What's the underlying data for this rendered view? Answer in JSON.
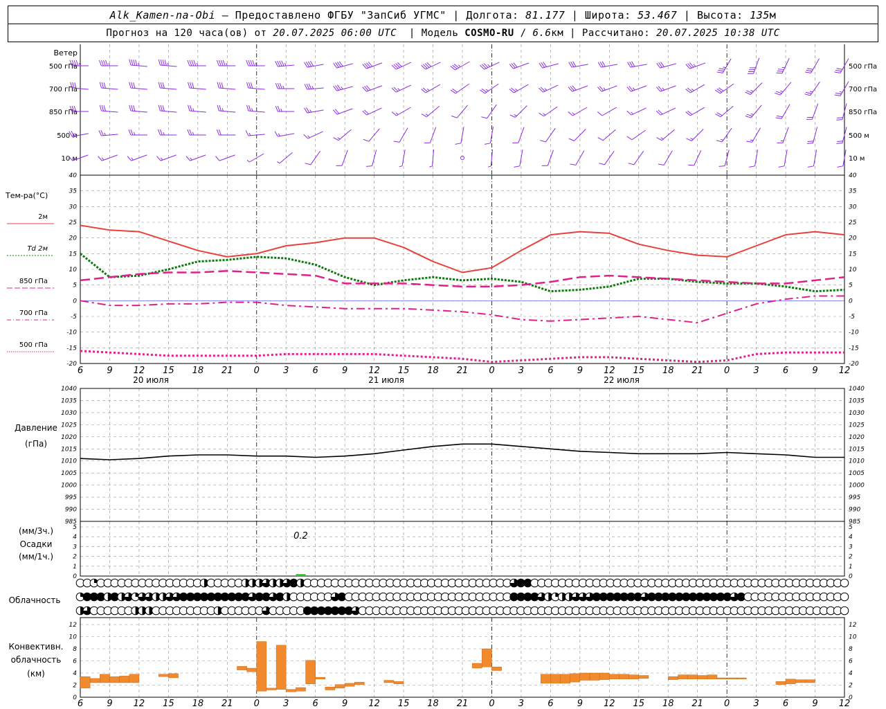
{
  "header": {
    "station": "Alk_Kamen-na-Obi",
    "provider": "Предоставлено ФГБУ \"ЗапСиб УГМС\"",
    "lon_label": "Долгота:",
    "lon": "81.177",
    "lat_label": "Широта:",
    "lat": "53.467",
    "alt_label": "Высота:",
    "alt": "135",
    "alt_unit": "м",
    "forecast_label": "Прогноз на 120 часа(ов) от",
    "forecast_time": "20.07.2025 06:00 UTC",
    "model_label": "Модель",
    "model": "COSMO-RU",
    "model_res": "6.6",
    "model_res_unit": "км",
    "calc_label": "Рассчитано:",
    "calc_time": "20.07.2025 10:38 UTC"
  },
  "colors": {
    "wind": "#8a2be2",
    "t2m": "#e8413c",
    "td2m": "#0a7a0a",
    "t850": "#e0208a",
    "t700": "#e0208a",
    "t500": "#e0208a",
    "pressure": "#000000",
    "precip": "#22cc22",
    "conv": "#f08a2c",
    "grid": "#999999"
  },
  "time_axis": {
    "hour_labels": [
      "6",
      "9",
      "12",
      "15",
      "18",
      "21",
      "0",
      "3",
      "6",
      "9",
      "12",
      "15",
      "18",
      "21",
      "0",
      "3",
      "6",
      "9",
      "12",
      "15",
      "18",
      "21",
      "0",
      "3",
      "6",
      "9",
      "12"
    ],
    "day_labels": [
      "20 июля",
      "21 июля",
      "22 июля"
    ]
  },
  "wind_panel": {
    "title": "Ветер",
    "levels": [
      "500 гПа",
      "700 гПа",
      "850 гПа",
      "500 м",
      "10 м"
    ]
  },
  "temp_panel": {
    "title": "Тем-ра(°С)",
    "legend": [
      "2м",
      "Td 2м",
      "850 гПа",
      "700 гПа",
      "500 гПа"
    ]
  },
  "pressure_panel": {
    "title": "Давление",
    "unit": "(гПа)"
  },
  "precip_panel": {
    "unit_top": "(мм/3ч.)",
    "title": "Осадки",
    "unit_bottom": "(мм/1ч.)",
    "max_label": "0.2"
  },
  "cloud_panel": {
    "title": "Облачность"
  },
  "conv_panel": {
    "title_line1": "Конвективн.",
    "title_line2": "облачность",
    "unit": "(км)"
  },
  "chart_data": [
    {
      "type": "line",
      "title": "Тем-ра(°С)",
      "ylim": [
        -20,
        40
      ],
      "y_ticks": [
        -20,
        -15,
        -10,
        -5,
        0,
        5,
        10,
        15,
        20,
        25,
        30,
        35,
        40
      ],
      "x_hours": [
        6,
        9,
        12,
        15,
        18,
        21,
        24,
        27,
        30,
        33,
        36,
        39,
        42,
        45,
        48,
        51,
        54,
        57,
        60,
        63,
        66,
        69,
        72,
        75,
        78,
        81,
        84
      ],
      "series": [
        {
          "name": "2м",
          "style": "solid",
          "values": [
            24,
            22.5,
            22,
            19,
            16,
            14,
            15,
            17.5,
            18.5,
            20,
            20,
            17,
            12.5,
            9,
            10.5,
            16,
            21,
            22,
            21.5,
            18,
            16,
            14.5,
            14,
            17.5,
            21,
            22,
            21
          ]
        },
        {
          "name": "Td 2м",
          "style": "dotted",
          "values": [
            15,
            7.5,
            8,
            10,
            12.5,
            13,
            14,
            13.5,
            11.5,
            7.5,
            5,
            6.5,
            7.5,
            6.5,
            7,
            6,
            3,
            3.5,
            4.5,
            7,
            7,
            6,
            5.5,
            5.5,
            4.5,
            3,
            3.5
          ]
        },
        {
          "name": "850 гПа",
          "style": "longdash",
          "values": [
            6.5,
            7.5,
            8.5,
            9,
            9,
            9.5,
            9,
            8.5,
            8,
            5.5,
            5.5,
            5.5,
            5,
            4.5,
            4.5,
            5,
            6,
            7.5,
            8,
            7.5,
            7,
            6.5,
            6,
            5.5,
            5.5,
            6.5,
            7.5
          ]
        },
        {
          "name": "700 гПа",
          "style": "dashdot",
          "values": [
            0,
            -1.5,
            -1.5,
            -1,
            -1,
            -0.5,
            -0.5,
            -1.5,
            -2,
            -2.5,
            -2.5,
            -2.5,
            -3,
            -3.5,
            -4.5,
            -6,
            -6.5,
            -6,
            -5.5,
            -5,
            -6,
            -7,
            -4,
            -1,
            0.5,
            1.5,
            1.5
          ]
        },
        {
          "name": "500 гПа",
          "style": "densedot",
          "values": [
            -16,
            -16.5,
            -17,
            -17.5,
            -17.5,
            -17.5,
            -17.5,
            -17,
            -17,
            -17,
            -17,
            -17.5,
            -18,
            -18.5,
            -19.5,
            -19,
            -18.5,
            -18,
            -18,
            -18.5,
            -19,
            -19.5,
            -19,
            -17,
            -16.5,
            -16.5,
            -16.5
          ]
        }
      ]
    },
    {
      "type": "line",
      "title": "Давление",
      "ylim": [
        985,
        1040
      ],
      "y_ticks": [
        985,
        990,
        995,
        1000,
        1005,
        1010,
        1015,
        1020,
        1025,
        1030,
        1035,
        1040
      ],
      "x_hours": [
        6,
        9,
        12,
        15,
        18,
        21,
        24,
        27,
        30,
        33,
        36,
        39,
        42,
        45,
        48,
        51,
        54,
        57,
        60,
        63,
        66,
        69,
        72,
        75,
        78,
        81,
        84
      ],
      "series": [
        {
          "name": "",
          "style": "solid",
          "values": [
            1011,
            1010.5,
            1011,
            1012,
            1012.5,
            1012.5,
            1012,
            1012,
            1011.5,
            1012,
            1013,
            1014.5,
            1016,
            1017,
            1017,
            1016,
            1015,
            1014,
            1013.5,
            1013,
            1013,
            1013,
            1013.5,
            1013,
            1012.5,
            1011.5,
            1011.5
          ]
        }
      ]
    },
    {
      "type": "bar",
      "title": "Осадки",
      "ylim": [
        0,
        5
      ],
      "y_ticks": [
        0,
        1,
        2,
        3,
        4,
        5
      ],
      "bars": [
        {
          "hour": 28.5,
          "value": 0.2
        }
      ]
    },
    {
      "type": "bar",
      "title": "Конвективн. облачность",
      "ylim": [
        0,
        12
      ],
      "y_ticks": [
        0,
        2,
        4,
        6,
        8,
        10,
        12
      ],
      "bars": [
        {
          "hour": 6.5,
          "base": 1.5,
          "top": 3.4
        },
        {
          "hour": 7.5,
          "base": 2.4,
          "top": 3.1
        },
        {
          "hour": 8.5,
          "base": 2.4,
          "top": 3.8
        },
        {
          "hour": 9.5,
          "base": 2.4,
          "top": 3.4
        },
        {
          "hour": 10.5,
          "base": 2.4,
          "top": 3.5
        },
        {
          "hour": 11.5,
          "base": 2.4,
          "top": 3.8
        },
        {
          "hour": 14.5,
          "base": 3.4,
          "top": 3.8
        },
        {
          "hour": 15.5,
          "base": 3.2,
          "top": 3.9
        },
        {
          "hour": 22.5,
          "base": 4.5,
          "top": 5.1
        },
        {
          "hour": 23.5,
          "base": 4.2,
          "top": 4.8
        },
        {
          "hour": 24.5,
          "base": 1.0,
          "top": 9.2
        },
        {
          "hour": 25.5,
          "base": 1.2,
          "top": 1.5
        },
        {
          "hour": 26.5,
          "base": 1.3,
          "top": 8.6
        },
        {
          "hour": 27.5,
          "base": 0.9,
          "top": 1.3
        },
        {
          "hour": 28.5,
          "base": 1.0,
          "top": 1.6
        },
        {
          "hour": 29.5,
          "base": 2.2,
          "top": 6.1
        },
        {
          "hour": 30.5,
          "base": 3.0,
          "top": 3.3
        },
        {
          "hour": 31.5,
          "base": 1.2,
          "top": 1.7
        },
        {
          "hour": 32.5,
          "base": 1.5,
          "top": 2.1
        },
        {
          "hour": 33.5,
          "base": 1.8,
          "top": 2.3
        },
        {
          "hour": 34.5,
          "base": 2.1,
          "top": 2.5
        },
        {
          "hour": 37.5,
          "base": 2.4,
          "top": 2.8
        },
        {
          "hour": 38.5,
          "base": 2.2,
          "top": 2.6
        },
        {
          "hour": 46.5,
          "base": 4.8,
          "top": 5.6
        },
        {
          "hour": 47.5,
          "base": 5.0,
          "top": 8.0
        },
        {
          "hour": 48.5,
          "base": 4.4,
          "top": 5.0
        },
        {
          "hour": 53.5,
          "base": 2.3,
          "top": 3.8
        },
        {
          "hour": 54.5,
          "base": 2.3,
          "top": 3.8
        },
        {
          "hour": 55.5,
          "base": 2.3,
          "top": 3.8
        },
        {
          "hour": 56.5,
          "base": 2.5,
          "top": 3.9
        },
        {
          "hour": 57.5,
          "base": 2.8,
          "top": 4.0
        },
        {
          "hour": 58.5,
          "base": 2.8,
          "top": 4.0
        },
        {
          "hour": 59.5,
          "base": 2.9,
          "top": 4.0
        },
        {
          "hour": 60.5,
          "base": 3.0,
          "top": 3.8
        },
        {
          "hour": 61.5,
          "base": 3.0,
          "top": 3.8
        },
        {
          "hour": 62.5,
          "base": 3.0,
          "top": 3.7
        },
        {
          "hour": 63.5,
          "base": 3.1,
          "top": 3.6
        },
        {
          "hour": 66.5,
          "base": 2.9,
          "top": 3.4
        },
        {
          "hour": 67.5,
          "base": 3.0,
          "top": 3.7
        },
        {
          "hour": 68.5,
          "base": 3.0,
          "top": 3.7
        },
        {
          "hour": 69.5,
          "base": 3.0,
          "top": 3.6
        },
        {
          "hour": 70.5,
          "base": 3.0,
          "top": 3.7
        },
        {
          "hour": 71.5,
          "base": 3.0,
          "top": 3.2
        },
        {
          "hour": 72.5,
          "base": 3.0,
          "top": 3.2
        },
        {
          "hour": 73.5,
          "base": 3.0,
          "top": 3.2
        },
        {
          "hour": 77.5,
          "base": 2.1,
          "top": 2.6
        },
        {
          "hour": 78.5,
          "base": 2.2,
          "top": 3.0
        },
        {
          "hour": 79.5,
          "base": 2.4,
          "top": 2.9
        },
        {
          "hour": 80.5,
          "base": 2.4,
          "top": 2.9
        }
      ]
    }
  ],
  "wind": {
    "speed_kt_by_level": [
      [
        45,
        45,
        45,
        45,
        45,
        45,
        45,
        45,
        40,
        40,
        40,
        40,
        40,
        35,
        35,
        30,
        30,
        30,
        30,
        30,
        30,
        35,
        35,
        40,
        35,
        30,
        30
      ],
      [
        30,
        30,
        30,
        30,
        30,
        30,
        30,
        35,
        35,
        35,
        30,
        25,
        25,
        20,
        25,
        25,
        25,
        30,
        25,
        25,
        25,
        25,
        30,
        25,
        25,
        25,
        25
      ],
      [
        30,
        30,
        30,
        30,
        25,
        25,
        25,
        25,
        25,
        20,
        20,
        15,
        15,
        10,
        10,
        15,
        15,
        15,
        10,
        15,
        20,
        20,
        20,
        25,
        20,
        20,
        20
      ],
      [
        25,
        25,
        25,
        25,
        25,
        20,
        15,
        15,
        15,
        15,
        10,
        10,
        10,
        10,
        10,
        10,
        10,
        10,
        10,
        10,
        15,
        15,
        15,
        15,
        15,
        20,
        20
      ],
      [
        15,
        15,
        15,
        15,
        15,
        10,
        5,
        5,
        10,
        10,
        10,
        5,
        5,
        0,
        5,
        10,
        10,
        10,
        10,
        10,
        10,
        10,
        10,
        10,
        10,
        10,
        10
      ]
    ],
    "dir_deg_by_level": [
      [
        270,
        270,
        275,
        275,
        270,
        270,
        270,
        265,
        260,
        255,
        250,
        245,
        245,
        240,
        245,
        250,
        255,
        260,
        260,
        260,
        255,
        250,
        210,
        200,
        205,
        210,
        210
      ],
      [
        275,
        275,
        275,
        275,
        275,
        275,
        275,
        270,
        265,
        255,
        250,
        245,
        240,
        235,
        235,
        240,
        245,
        250,
        250,
        250,
        250,
        240,
        235,
        225,
        220,
        215,
        210
      ],
      [
        270,
        275,
        275,
        275,
        275,
        275,
        275,
        270,
        260,
        250,
        245,
        240,
        230,
        220,
        215,
        225,
        235,
        240,
        240,
        245,
        245,
        240,
        230,
        220,
        210,
        200,
        195
      ],
      [
        260,
        265,
        270,
        270,
        270,
        270,
        265,
        260,
        245,
        230,
        220,
        210,
        200,
        190,
        190,
        200,
        215,
        225,
        230,
        235,
        230,
        225,
        215,
        210,
        200,
        195,
        195
      ],
      [
        250,
        250,
        250,
        250,
        250,
        250,
        240,
        230,
        215,
        200,
        195,
        190,
        185,
        180,
        185,
        190,
        200,
        210,
        215,
        215,
        210,
        205,
        195,
        190,
        190,
        190,
        190
      ]
    ]
  },
  "clouds": {
    "rows": [
      [
        0,
        0,
        1,
        0,
        0,
        0,
        0,
        0,
        0,
        0,
        0,
        0,
        0,
        0,
        0,
        0,
        0,
        0,
        2,
        0,
        0,
        0,
        0,
        0,
        2,
        2,
        2,
        3,
        2,
        2,
        3,
        4,
        2,
        0,
        0,
        0,
        0,
        0,
        0,
        0,
        0,
        0,
        0,
        0,
        0,
        0,
        0,
        0,
        0,
        0,
        0,
        0,
        0,
        0,
        0,
        0,
        0,
        0,
        0,
        0,
        0,
        0,
        0,
        3,
        4,
        4,
        0,
        0,
        0,
        0,
        0,
        0,
        0,
        0,
        0,
        0,
        0,
        0,
        0,
        0,
        0,
        0,
        0,
        0,
        0,
        0,
        0,
        0,
        0,
        0,
        0,
        0,
        0,
        0,
        0,
        0,
        0,
        0,
        0,
        0,
        0,
        0,
        0,
        0,
        0,
        0,
        0,
        0,
        0,
        0,
        0,
        0
      ],
      [
        1,
        4,
        4,
        4,
        2,
        4,
        2,
        3,
        1,
        3,
        3,
        2,
        2,
        3,
        3,
        4,
        4,
        4,
        4,
        4,
        4,
        4,
        4,
        4,
        4,
        3,
        4,
        4,
        3,
        4,
        2,
        0,
        0,
        0,
        0,
        0,
        0,
        3,
        4,
        0,
        0,
        0,
        0,
        0,
        0,
        0,
        0,
        0,
        0,
        0,
        0,
        0,
        0,
        0,
        0,
        0,
        0,
        0,
        0,
        0,
        0,
        0,
        0,
        4,
        4,
        4,
        4,
        3,
        2,
        1,
        2,
        2,
        3,
        3,
        3,
        4,
        4,
        4,
        4,
        4,
        4,
        4,
        3,
        4,
        4,
        4,
        4,
        4,
        4,
        4,
        4,
        4,
        4,
        4,
        4,
        3,
        4,
        0,
        0,
        0,
        0,
        0,
        0,
        0,
        0,
        0,
        0,
        0,
        0,
        0,
        0,
        0
      ],
      [
        2,
        3,
        0,
        0,
        0,
        0,
        0,
        0,
        2,
        2,
        2,
        0,
        0,
        0,
        0,
        0,
        0,
        0,
        0,
        0,
        2,
        0,
        0,
        0,
        0,
        0,
        0,
        3,
        0,
        0,
        0,
        0,
        0,
        4,
        4,
        4,
        4,
        4,
        4,
        4,
        3,
        0,
        0,
        0,
        0,
        0,
        0,
        0,
        0,
        0,
        0,
        0,
        0,
        0,
        0,
        0,
        0,
        0,
        0,
        0,
        0,
        0,
        0,
        0,
        0,
        0,
        0,
        0,
        0,
        0,
        0,
        0,
        0,
        0,
        0,
        0,
        0,
        0,
        0,
        0,
        0,
        0,
        0,
        0,
        0,
        0,
        0,
        0,
        0,
        0,
        0,
        0,
        0,
        0,
        0,
        0,
        0,
        0,
        0,
        0,
        0,
        0,
        0,
        0,
        0,
        0,
        0,
        0,
        0,
        0,
        0,
        0
      ]
    ]
  }
}
